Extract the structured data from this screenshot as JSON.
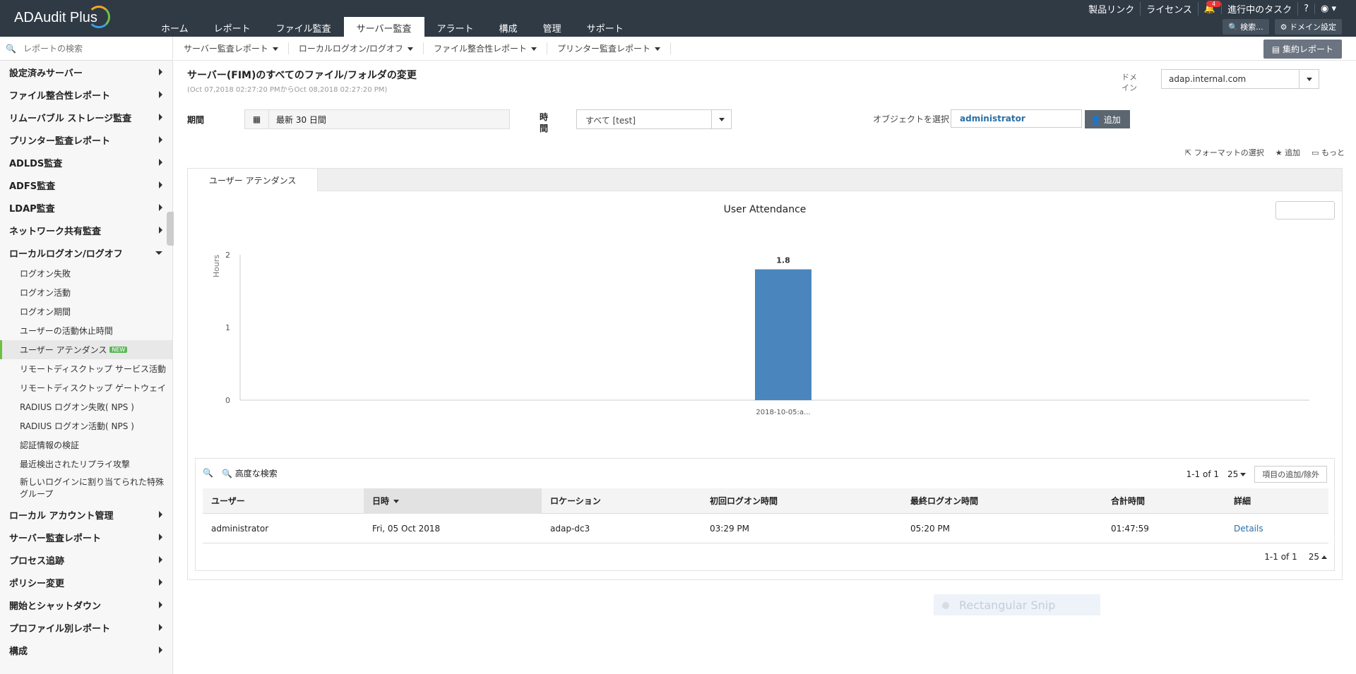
{
  "app": {
    "logo": "ADAudit Plus"
  },
  "nav": {
    "tabs": [
      "ホーム",
      "レポート",
      "ファイル監査",
      "サーバー監査",
      "アラート",
      "構成",
      "管理",
      "サポート"
    ],
    "active": 3
  },
  "toplinks": {
    "products": "製品リンク",
    "license": "ライセンス",
    "bell_count": "4",
    "tasks": "進行中のタスク",
    "help": "?",
    "user": "●"
  },
  "topbuttons": {
    "search": "検索...",
    "domain_settings": "ドメイン設定"
  },
  "sidebar": {
    "search_placeholder": "レポートの検索",
    "items": [
      {
        "label": "設定済みサーバー"
      },
      {
        "label": "ファイル整合性レポート"
      },
      {
        "label": "リムーバブル ストレージ監査"
      },
      {
        "label": "プリンター監査レポート"
      },
      {
        "label": "ADLDS監査"
      },
      {
        "label": "ADFS監査"
      },
      {
        "label": "LDAP監査"
      },
      {
        "label": "ネットワーク共有監査"
      },
      {
        "label": "ローカルログオン/ログオフ"
      }
    ],
    "subitems": [
      "ログオン失敗",
      "ログオン活動",
      "ログオン期間",
      "ユーザーの活動休止時間",
      "ユーザー アテンダンス",
      "リモートディスクトップ サービス活動",
      "リモートディスクトップ ゲートウェイ",
      "RADIUS ログオン失敗( NPS )",
      "RADIUS ログオン活動( NPS )",
      "認証情報の検証",
      "最近検出されたリプライ攻撃",
      "新しいログインに割り当てられた特殊グループ"
    ],
    "new_badge": "NEW",
    "items_after": [
      {
        "label": "ローカル アカウント管理"
      },
      {
        "label": "サーバー監査レポート"
      },
      {
        "label": "プロセス追跡"
      },
      {
        "label": "ポリシー変更"
      },
      {
        "label": "開始とシャットダウン"
      },
      {
        "label": "プロファイル別レポート"
      },
      {
        "label": "構成"
      }
    ]
  },
  "subnav": {
    "items": [
      "サーバー監査レポート",
      "ローカルログオン/ログオフ",
      "ファイル整合性レポート",
      "プリンター監査レポート"
    ],
    "summary": "集約レポート"
  },
  "report": {
    "title": "サーバー(FIM)のすべてのファイル/フォルダの変更",
    "subtitle": "(Oct 07,2018 02:27:20 PMからOct 08,2018 02:27:20 PM)",
    "domain_label": "ドメイン",
    "domain_value": "adap.internal.com",
    "period_label": "期間",
    "period_value": "最新 30 日間",
    "time_label": "時間",
    "time_value": "すべて [test]",
    "object_label": "オブジェクトを選択",
    "object_value": "administrator",
    "add_label": "追加",
    "actions": [
      "フォーマットの選択",
      "追加",
      "もっと"
    ],
    "tab_label": "ユーザー アテンダンス"
  },
  "chart_data": {
    "type": "bar",
    "title": "User Attendance",
    "ylabel": "Hours",
    "xlabel": "",
    "categories": [
      "2018-10-05:a..."
    ],
    "values": [
      1.8
    ],
    "data_labels": [
      "1.8"
    ],
    "ylim": [
      0,
      2
    ],
    "yticks": [
      0,
      1,
      2
    ],
    "bar_color": "#4a86bd",
    "grid": false
  },
  "table": {
    "advanced_search": "高度な検索",
    "pager_text": "1-1 of 1",
    "page_size": "25",
    "columns_button": "項目の追加/除外",
    "headers": [
      "ユーザー",
      "日時",
      "ロケーション",
      "初回ログオン時間",
      "最終ログオン時間",
      "合計時間",
      "詳細"
    ],
    "rows": [
      [
        "administrator",
        "Fri, 05 Oct 2018",
        "adap-dc3",
        "03:29 PM",
        "05:20 PM",
        "01:47:59",
        "Details"
      ]
    ]
  },
  "overlay": {
    "snip": "Rectangular Snip"
  },
  "colors": {
    "topbar": "#2f3a45",
    "accent_green": "#6fbf3f",
    "link": "#2a6ea6"
  }
}
